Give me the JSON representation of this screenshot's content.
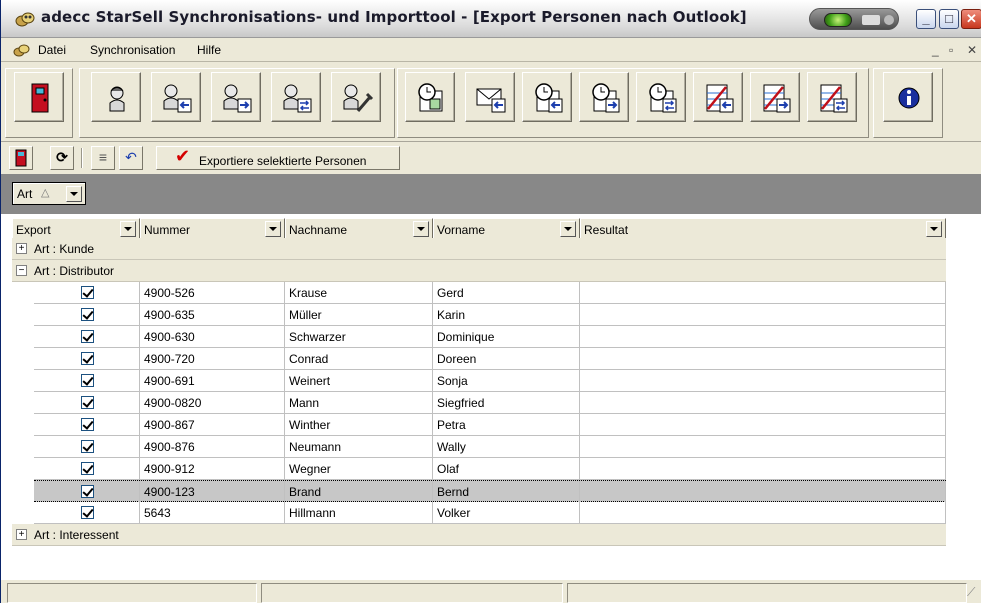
{
  "window": {
    "title": "adecc StarSell Synchronisations- und Importtool - [Export Personen nach Outlook]"
  },
  "menu": {
    "items": [
      {
        "label": "Datei"
      },
      {
        "label": "Synchronisation"
      },
      {
        "label": "Hilfe"
      }
    ]
  },
  "toolbar": {
    "main_buttons": [
      {
        "icon": "exit-door-icon"
      },
      {
        "icon": "person-icon"
      },
      {
        "icon": "person-import-icon"
      },
      {
        "icon": "person-export-icon"
      },
      {
        "icon": "person-sync-icon"
      },
      {
        "icon": "person-settings-icon"
      },
      {
        "icon": "calendar-clock-icon"
      },
      {
        "icon": "mail-import-icon"
      },
      {
        "icon": "calendar-import-icon"
      },
      {
        "icon": "calendar-export-icon"
      },
      {
        "icon": "calendar-sync-icon"
      },
      {
        "icon": "task-import-icon"
      },
      {
        "icon": "task-export-icon"
      },
      {
        "icon": "task-sync-icon"
      },
      {
        "icon": "info-icon"
      }
    ],
    "export_label": "Exportiere selektierte Personen"
  },
  "groupby": {
    "label": "Art"
  },
  "grid": {
    "columns": [
      "Export",
      "Nummer",
      "Nachname",
      "Vorname",
      "Resultat"
    ],
    "groups": [
      {
        "label": "Art : Kunde",
        "expanded": false
      },
      {
        "label": "Art : Distributor",
        "expanded": true
      },
      {
        "label": "Art : Interessent",
        "expanded": false
      }
    ],
    "rows": [
      {
        "export": true,
        "nummer": "4900-526",
        "nachname": "Krause",
        "vorname": "Gerd",
        "resultat": ""
      },
      {
        "export": true,
        "nummer": "4900-635",
        "nachname": "Müller",
        "vorname": "Karin",
        "resultat": ""
      },
      {
        "export": true,
        "nummer": "4900-630",
        "nachname": "Schwarzer",
        "vorname": "Dominique",
        "resultat": ""
      },
      {
        "export": true,
        "nummer": "4900-720",
        "nachname": "Conrad",
        "vorname": "Doreen",
        "resultat": ""
      },
      {
        "export": true,
        "nummer": "4900-691",
        "nachname": "Weinert",
        "vorname": "Sonja",
        "resultat": ""
      },
      {
        "export": true,
        "nummer": "4900-0820",
        "nachname": "Mann",
        "vorname": "Siegfried",
        "resultat": ""
      },
      {
        "export": true,
        "nummer": "4900-867",
        "nachname": "Winther",
        "vorname": "Petra",
        "resultat": ""
      },
      {
        "export": true,
        "nummer": "4900-876",
        "nachname": "Neumann",
        "vorname": "Wally",
        "resultat": ""
      },
      {
        "export": true,
        "nummer": "4900-912",
        "nachname": "Wegner",
        "vorname": "Olaf",
        "resultat": ""
      },
      {
        "export": true,
        "nummer": "4900-123",
        "nachname": "Brand",
        "vorname": "Bernd",
        "resultat": "",
        "selected": true
      },
      {
        "export": true,
        "nummer": "5643",
        "nachname": "Hillmann",
        "vorname": "Volker",
        "resultat": ""
      }
    ]
  }
}
